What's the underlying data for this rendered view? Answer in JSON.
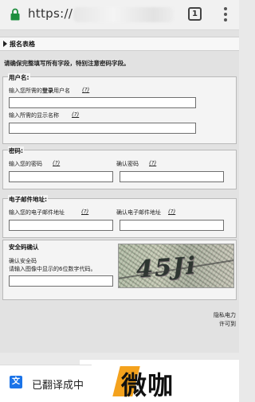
{
  "browser": {
    "url_prefix": "https://",
    "tab_count": "1",
    "icons": [
      "lock-icon",
      "tab-switcher-icon",
      "more-options-icon"
    ]
  },
  "form": {
    "section_title": "报名表格",
    "intro": "请确保完整填写所有字段，特别注意密码字段。",
    "help_symbol": "(?)",
    "username": {
      "legend": "用户名:",
      "login_label_pre": "输入您所需的",
      "login_label_bold": "登录",
      "login_label_post": "用户名",
      "display_label": "输入所需的显示名称"
    },
    "password": {
      "legend": "密码:",
      "password_label": "输入您的密码",
      "confirm_label": "确认密码"
    },
    "email": {
      "legend": "电子邮件地址:",
      "email_label": "输入您的电子邮件地址",
      "confirm_label": "确认电子邮件地址"
    },
    "captcha": {
      "legend": "安全码确认",
      "label": "确认安全码",
      "hint": "请输入图像中显示的6位数字代码。",
      "image_text": "45Ji"
    },
    "footer_lines": [
      "隐私电力",
      "许可到"
    ]
  },
  "translate_bar": {
    "icon_label": "文",
    "text": "已翻译成中"
  },
  "watermark": {
    "text": "微咖"
  }
}
